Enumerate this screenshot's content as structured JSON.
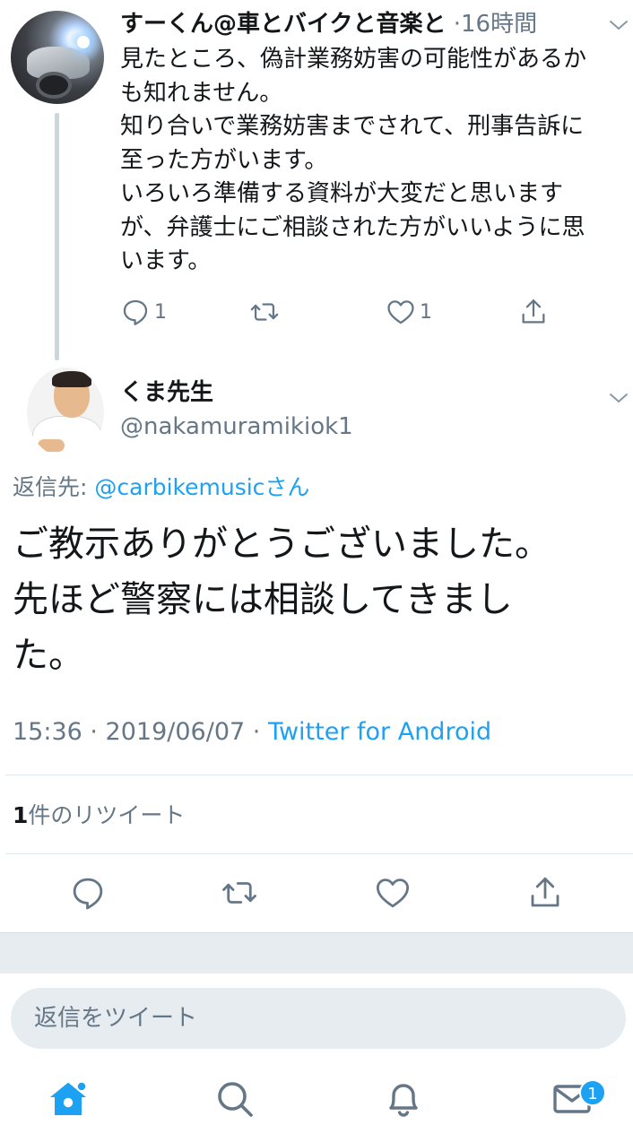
{
  "parent_tweet": {
    "author_name": "すーくん@車とバイクと音楽と",
    "meta": "·16時間",
    "text_lines": [
      "見たところ、偽計業務妨害の可能性があるか",
      "も知れません。",
      "知り合いで業務妨害までされて、刑事告訴に",
      "至った方がいます。",
      "いろいろ準備する資料が大変だと思います",
      "が、弁護士にご相談された方がいいように思",
      "います。"
    ],
    "reply_count": "1",
    "like_count": "1"
  },
  "focused_tweet": {
    "author_name": "くま先生",
    "handle": "@nakamuramikiok1",
    "reply_prefix": "返信先: ",
    "reply_to": "@carbikemusicさん",
    "text_lines": [
      "ご教示ありがとうございました。",
      "先ほど警察には相談してきまし",
      "た。"
    ],
    "timestamp": "15:36 · 2019/06/07 · ",
    "source": "Twitter for Android",
    "retweet_number": "1",
    "retweet_label": "件のリツイート"
  },
  "reply_box": {
    "placeholder": "返信をツイート"
  },
  "tabbar": {
    "messages_badge": "1"
  },
  "colors": {
    "accent": "#1da1f2",
    "secondary_text": "#657786",
    "icon_gray": "#657786",
    "divider": "#e1e8ed"
  },
  "icons": {
    "reply": "reply-icon",
    "retweet": "retweet-icon",
    "like": "heart-icon",
    "share": "share-icon",
    "home": "home-icon",
    "search": "search-icon",
    "notifications": "bell-icon",
    "messages": "envelope-icon",
    "caret": "chevron-down-icon"
  }
}
